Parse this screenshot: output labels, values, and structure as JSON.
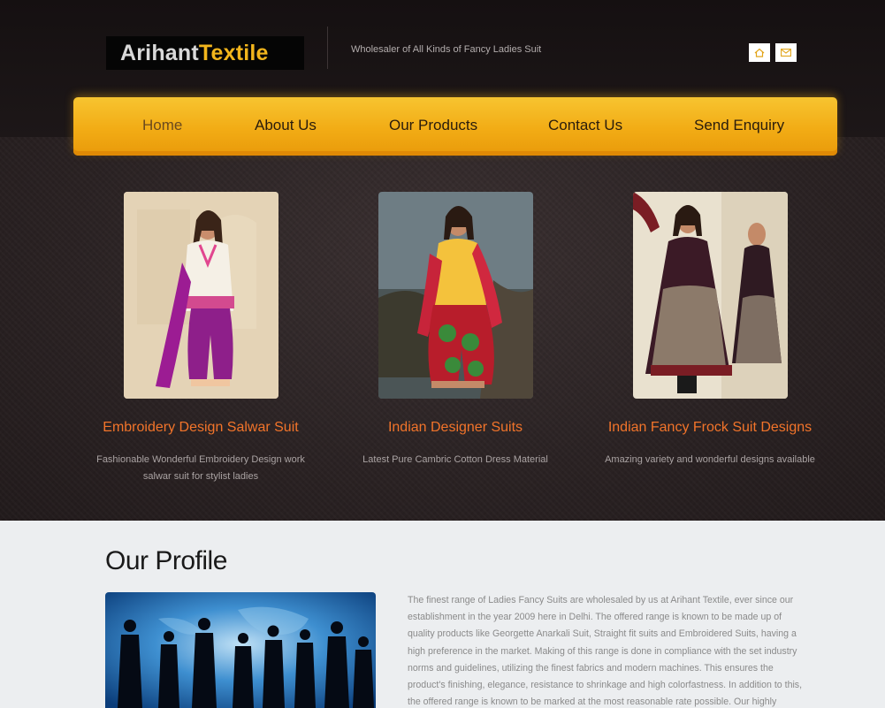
{
  "header": {
    "logo_part1": "Arihant",
    "logo_part2": "Textile",
    "tagline": "Wholesaler of All Kinds of Fancy Ladies Suit",
    "icons": [
      "home-icon",
      "mail-icon"
    ]
  },
  "nav": {
    "items": [
      "Home",
      "About Us",
      "Our Products",
      "Contact Us",
      "Send Enquiry"
    ],
    "active": "Home"
  },
  "products": [
    {
      "title": "Embroidery Design Salwar Suit",
      "description": "Fashionable Wonderful Embroidery Design work salwar suit for stylist ladies"
    },
    {
      "title": "Indian Designer Suits",
      "description": "Latest Pure Cambric Cotton Dress Material"
    },
    {
      "title": "Indian Fancy Frock Suit Designs",
      "description": "Amazing variety and wonderful designs available"
    }
  ],
  "profile": {
    "heading": "Our Profile",
    "text": "The finest range of Ladies Fancy Suits are wholesaled by us at Arihant Textile, ever since our establishment in the year 2009 here in Delhi. The offered range is known to be made up of quality products like Georgette Anarkali Suit, Straight fit suits and Embroidered Suits, having a high preference in the market. Making of this range is done in compliance with the set industry norms and guidelines, utilizing the finest fabrics and modern machines. This ensures the product's finishing, elegance, resistance to shrinkage and high colorfastness. In addition to this, the offered range is known to be marked at the most reasonable rate possible. Our highly"
  },
  "colors": {
    "accent_orange": "#f2ac15",
    "title_orange": "#f2742a",
    "logo_yellow": "#f2b51c",
    "dark_bg": "#2a2223"
  }
}
